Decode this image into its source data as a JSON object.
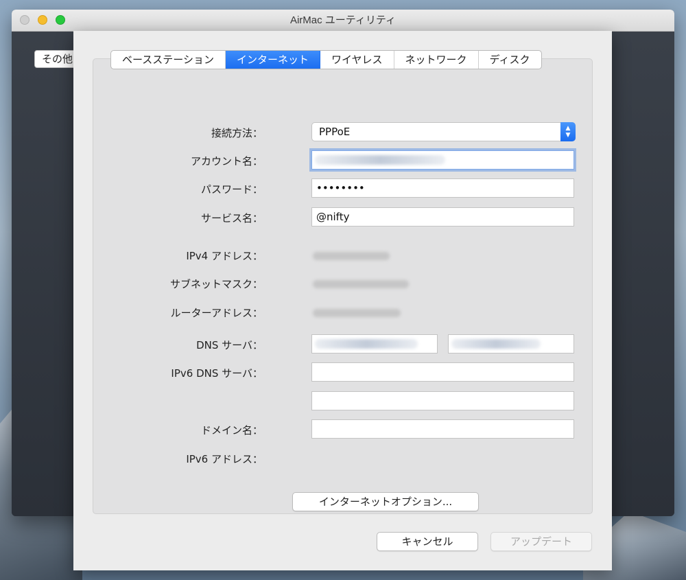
{
  "window": {
    "title": "AirMac ユーティリティ"
  },
  "sidebar": {
    "other_label": "その他"
  },
  "tabs": [
    {
      "label": "ベースステーション",
      "active": false
    },
    {
      "label": "インターネット",
      "active": true
    },
    {
      "label": "ワイヤレス",
      "active": false
    },
    {
      "label": "ネットワーク",
      "active": false
    },
    {
      "label": "ディスク",
      "active": false
    }
  ],
  "form": {
    "connection_label": "接続方法：",
    "connection_value": "PPPoE",
    "account_label": "アカウント名：",
    "password_label": "パスワード：",
    "password_value": "••••••••",
    "service_label": "サービス名：",
    "service_value": "@nifty",
    "ipv4_label": "IPv4 アドレス：",
    "subnet_label": "サブネットマスク：",
    "router_label": "ルーターアドレス：",
    "dns_label": "DNS サーバ：",
    "ipv6_dns_label": "IPv6 DNS サーバ：",
    "domain_label": "ドメイン名：",
    "ipv6_addr_label": "IPv6 アドレス：",
    "internet_options_button": "インターネットオプション..."
  },
  "footer": {
    "cancel_button": "キャンセル",
    "update_button": "アップデート"
  },
  "colors": {
    "accent": "#1c6ef0",
    "traffic_close": "#cfcfcf",
    "traffic_minimize": "#f5bd2e",
    "traffic_maximize": "#27c93f"
  }
}
